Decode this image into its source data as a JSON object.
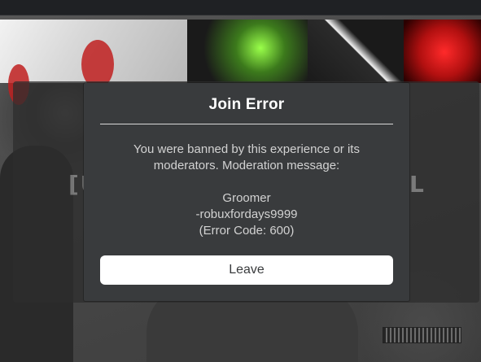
{
  "dialog": {
    "title": "Join Error",
    "message_lines": [
      "You were banned by this experience or its",
      "moderators. Moderation message:"
    ],
    "moderation_message": "Groomer",
    "moderation_detail": "-robuxfordays9999",
    "error_code": "(Error Code: 600)",
    "leave_label": "Leave"
  },
  "background": {
    "ghost_left": "[U",
    "ghost_right": "L",
    "colors": {
      "modal_bg": "#393b3d",
      "button_bg": "#ffffff",
      "accent_red": "#c02020"
    }
  }
}
